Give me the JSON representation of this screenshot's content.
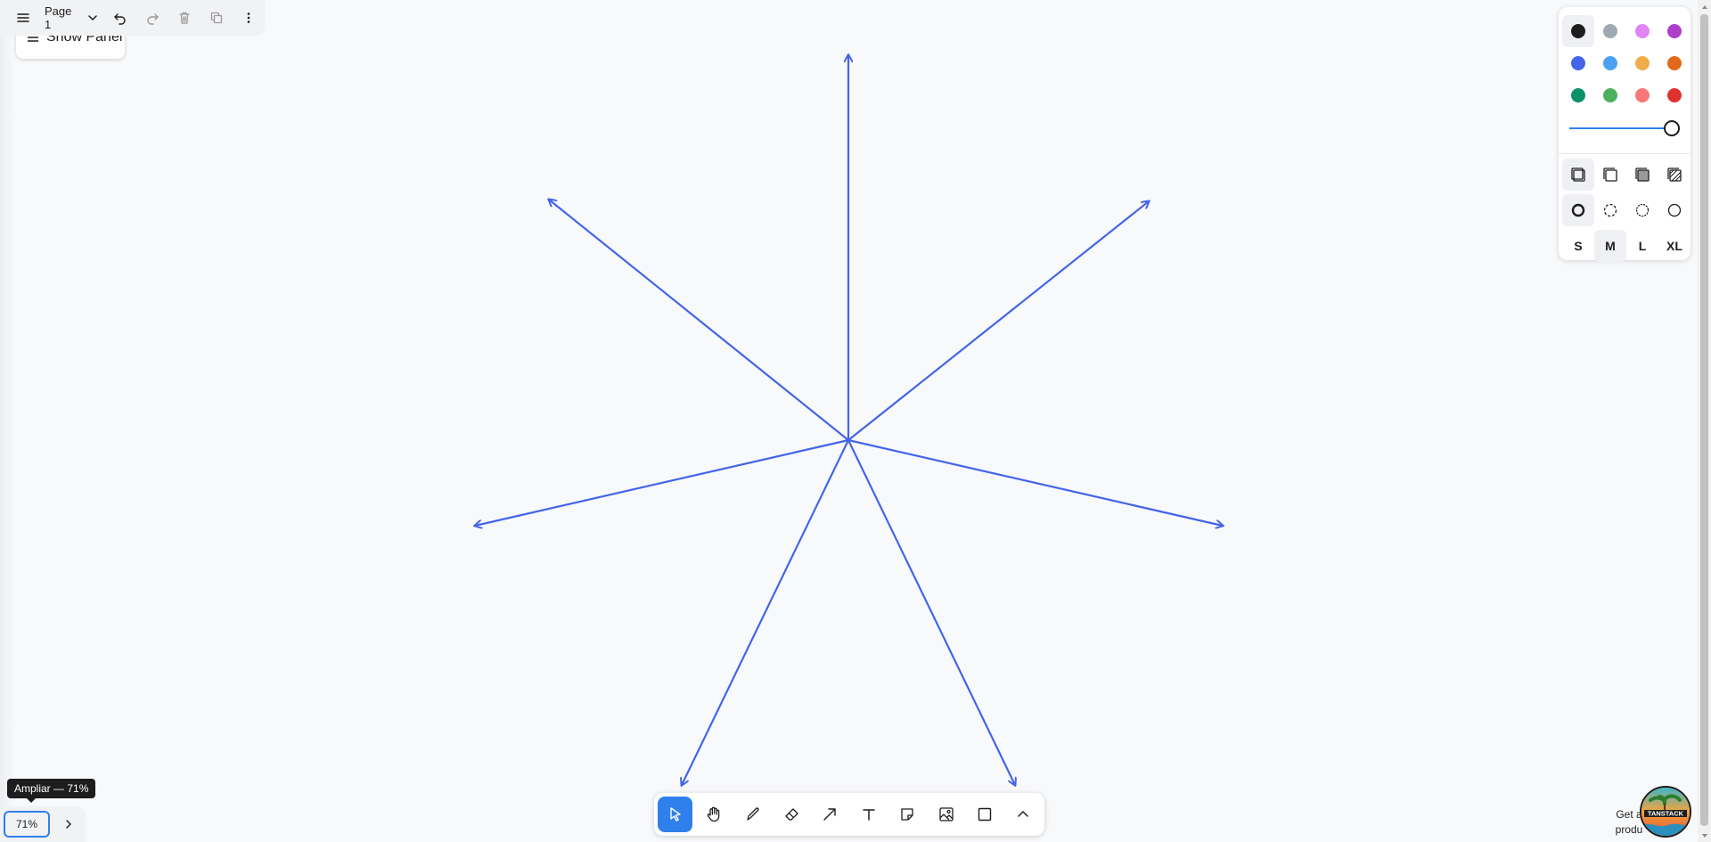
{
  "top_menu": {
    "page_label": "Page 1",
    "show_panel_label": "Show Panel"
  },
  "style_panel": {
    "colors": [
      {
        "name": "black",
        "hex": "#1d1d1d"
      },
      {
        "name": "grey",
        "hex": "#9fa8b2"
      },
      {
        "name": "light-violet",
        "hex": "#e085f4"
      },
      {
        "name": "violet",
        "hex": "#ae3ec9"
      },
      {
        "name": "blue",
        "hex": "#4465e9"
      },
      {
        "name": "light-blue",
        "hex": "#4ba1f1"
      },
      {
        "name": "yellow",
        "hex": "#f1ac4b"
      },
      {
        "name": "orange",
        "hex": "#e16919"
      },
      {
        "name": "green",
        "hex": "#099268"
      },
      {
        "name": "light-green",
        "hex": "#4cb05e"
      },
      {
        "name": "light-red",
        "hex": "#f87777"
      },
      {
        "name": "red",
        "hex": "#e03131"
      }
    ],
    "selected_color": "black",
    "opacity": 1.0,
    "sizes": [
      "S",
      "M",
      "L",
      "XL"
    ],
    "selected_size": "M"
  },
  "canvas": {
    "arrow_color": "#4465e9"
  },
  "toolbar": {
    "active_tool": "select"
  },
  "zoom": {
    "value": "71%",
    "tooltip": "Ampliar — 71%"
  },
  "sponsor": {
    "text": "Get a",
    "text2": "produ",
    "logo_text": "TANSTACK"
  }
}
